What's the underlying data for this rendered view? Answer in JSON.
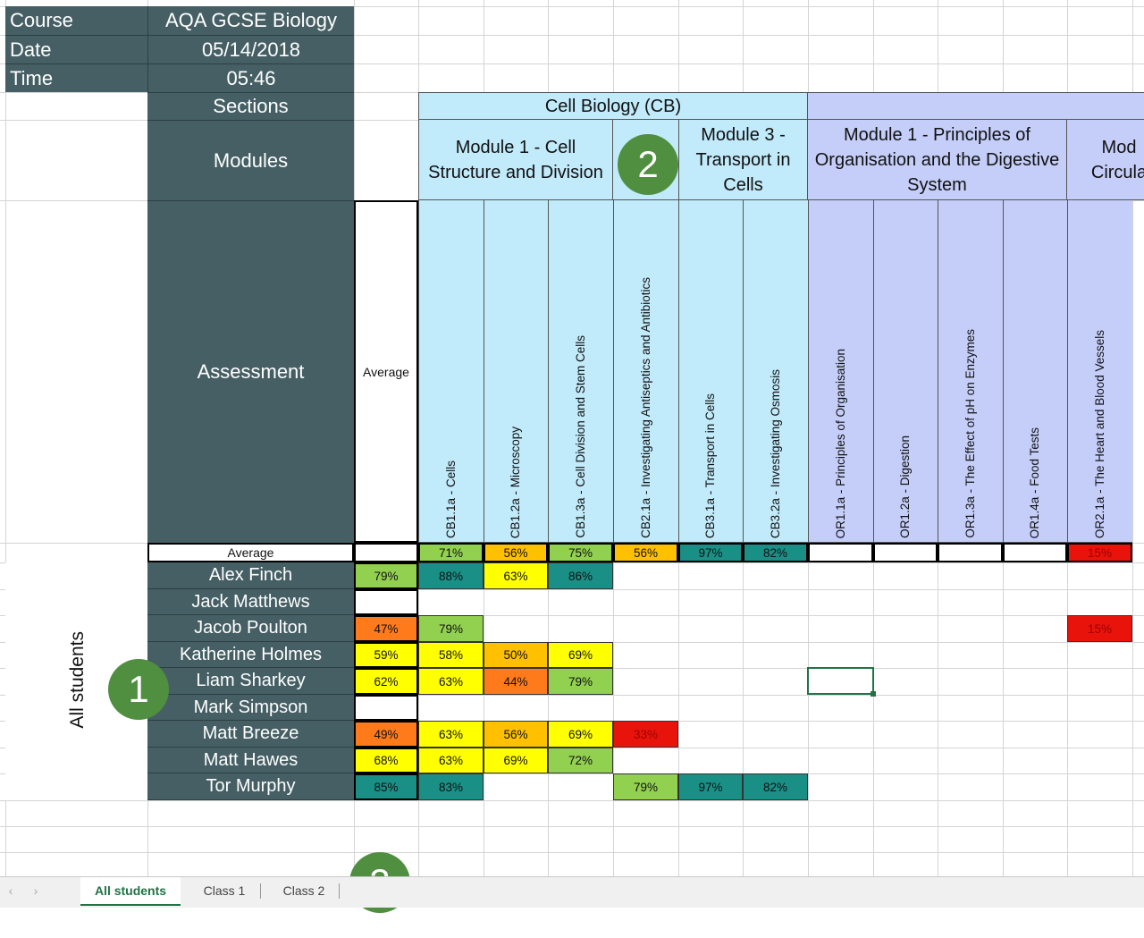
{
  "course_label": "Course",
  "course_value": "AQA GCSE Biology",
  "date_label": "Date",
  "date_value": "05/14/2018",
  "time_label": "Time",
  "time_value": "05:46",
  "sections_label": "Sections",
  "modules_label": "Modules",
  "assessment_label": "Assessment",
  "average_header": "Average",
  "average_row_label": "Average",
  "group_label": "All students",
  "sections": {
    "cb": "Cell Biology (CB)"
  },
  "modules": {
    "m1": "Module 1 - Cell Structure and Division",
    "m3": "Module 3 - Transport in Cells",
    "or1": "Module 1 - Principles of Organisation and the Digestive System",
    "or2": "Mod Circula"
  },
  "assessments": [
    "CB1.1a - Cells",
    "CB1.2a - Microscopy",
    "CB1.3a - Cell Division and Stem Cells",
    "CB2.1a - Investigating Antiseptics and Antibiotics",
    "CB3.1a - Transport in Cells",
    "CB3.2a - Investigating Osmosis",
    "OR1.1a - Principles of Organisation",
    "OR1.2a - Digestion",
    "OR1.3a - The Effect of pH on Enzymes",
    "OR1.4a - Food Tests",
    "OR2.1a - The Heart and Blood Vessels"
  ],
  "column_averages": [
    "71%",
    "56%",
    "75%",
    "56%",
    "97%",
    "82%",
    "",
    "",
    "",
    "",
    "15%"
  ],
  "students": [
    {
      "name": "Alex Finch",
      "avg": "79%",
      "scores": [
        "88%",
        "63%",
        "86%",
        "",
        "",
        "",
        "",
        "",
        "",
        "",
        ""
      ]
    },
    {
      "name": "Jack Matthews",
      "avg": "",
      "scores": [
        "",
        "",
        "",
        "",
        "",
        "",
        "",
        "",
        "",
        "",
        ""
      ]
    },
    {
      "name": "Jacob Poulton",
      "avg": "47%",
      "scores": [
        "79%",
        "",
        "",
        "",
        "",
        "",
        "",
        "",
        "",
        "",
        "15%"
      ]
    },
    {
      "name": "Katherine Holmes",
      "avg": "59%",
      "scores": [
        "58%",
        "50%",
        "69%",
        "",
        "",
        "",
        "",
        "",
        "",
        "",
        ""
      ]
    },
    {
      "name": "Liam Sharkey",
      "avg": "62%",
      "scores": [
        "63%",
        "44%",
        "79%",
        "",
        "",
        "",
        "",
        "",
        "",
        "",
        ""
      ]
    },
    {
      "name": "Mark Simpson",
      "avg": "",
      "scores": [
        "",
        "",
        "",
        "",
        "",
        "",
        "",
        "",
        "",
        "",
        ""
      ]
    },
    {
      "name": "Matt Breeze",
      "avg": "49%",
      "scores": [
        "63%",
        "56%",
        "69%",
        "33%",
        "",
        "",
        "",
        "",
        "",
        "",
        ""
      ]
    },
    {
      "name": "Matt Hawes",
      "avg": "68%",
      "scores": [
        "63%",
        "69%",
        "72%",
        "",
        "",
        "",
        "",
        "",
        "",
        "",
        ""
      ]
    },
    {
      "name": "Tor Murphy",
      "avg": "85%",
      "scores": [
        "83%",
        "",
        "",
        "79%",
        "97%",
        "82%",
        "",
        "",
        "",
        "",
        ""
      ]
    }
  ],
  "callouts": [
    "1",
    "2",
    "3"
  ],
  "tabs": [
    {
      "label": "All students",
      "active": true
    },
    {
      "label": "Class 1",
      "active": false
    },
    {
      "label": "Class 2",
      "active": false
    }
  ],
  "score_colors": {
    "dark_teal": "#1a8f86",
    "lime": "#92d050",
    "yellow": "#ffff00",
    "amber": "#ffc000",
    "orange": "#ff7a1a",
    "red": "#e8140c",
    "header_cb": "#c1eafa",
    "header_or": "#c5cef9",
    "panel_dark": "#455f64",
    "badge_green": "#4f8f3f"
  }
}
